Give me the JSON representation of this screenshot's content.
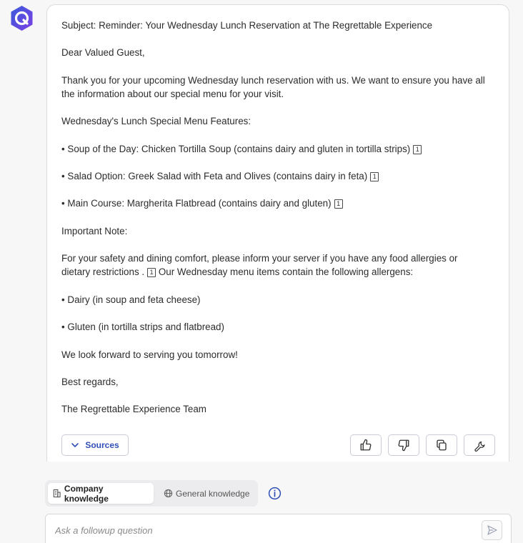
{
  "message": {
    "subject": "Subject: Reminder: Your Wednesday Lunch Reservation at The Regrettable Experience",
    "greeting": "Dear Valued Guest,",
    "intro": "Thank you for your upcoming Wednesday lunch reservation with us. We want to ensure you have all the information about our special menu for your visit.",
    "features_heading": "Wednesday's Lunch Special Menu Features:",
    "menu_items": [
      "• Soup of the Day: Chicken Tortilla Soup (contains dairy and gluten in tortilla strips)",
      "• Salad Option: Greek Salad with Feta and Olives (contains dairy in feta)",
      "• Main Course: Margherita Flatbread (contains dairy and gluten)"
    ],
    "note_heading": "Important Note:",
    "safety_text": "For your safety and dining comfort, please inform your server if you have any food allergies or dietary restrictions .",
    "safety_text_after": "Our Wednesday menu items contain the following allergens:",
    "allergens": [
      "• Dairy (in soup and feta cheese)",
      "• Gluten (in tortilla strips and flatbread)"
    ],
    "closing": "We look forward to serving you tomorrow!",
    "signoff": "Best regards,",
    "signature": "The Regrettable Experience Team",
    "citation": "1"
  },
  "actions": {
    "sources_label": "Sources",
    "icons": [
      "thumbs-up-icon",
      "thumbs-down-icon",
      "copy-icon",
      "wrench-icon"
    ]
  },
  "knowledge_toggle": {
    "company_label": "Company knowledge",
    "general_label": "General knowledge",
    "selected": "Company knowledge"
  },
  "input": {
    "placeholder": "Ask a followup question"
  },
  "colors": {
    "accent": "#2f4fb5",
    "logo_gradient_start": "#3a5bd9",
    "logo_gradient_end": "#7b3fe4"
  }
}
